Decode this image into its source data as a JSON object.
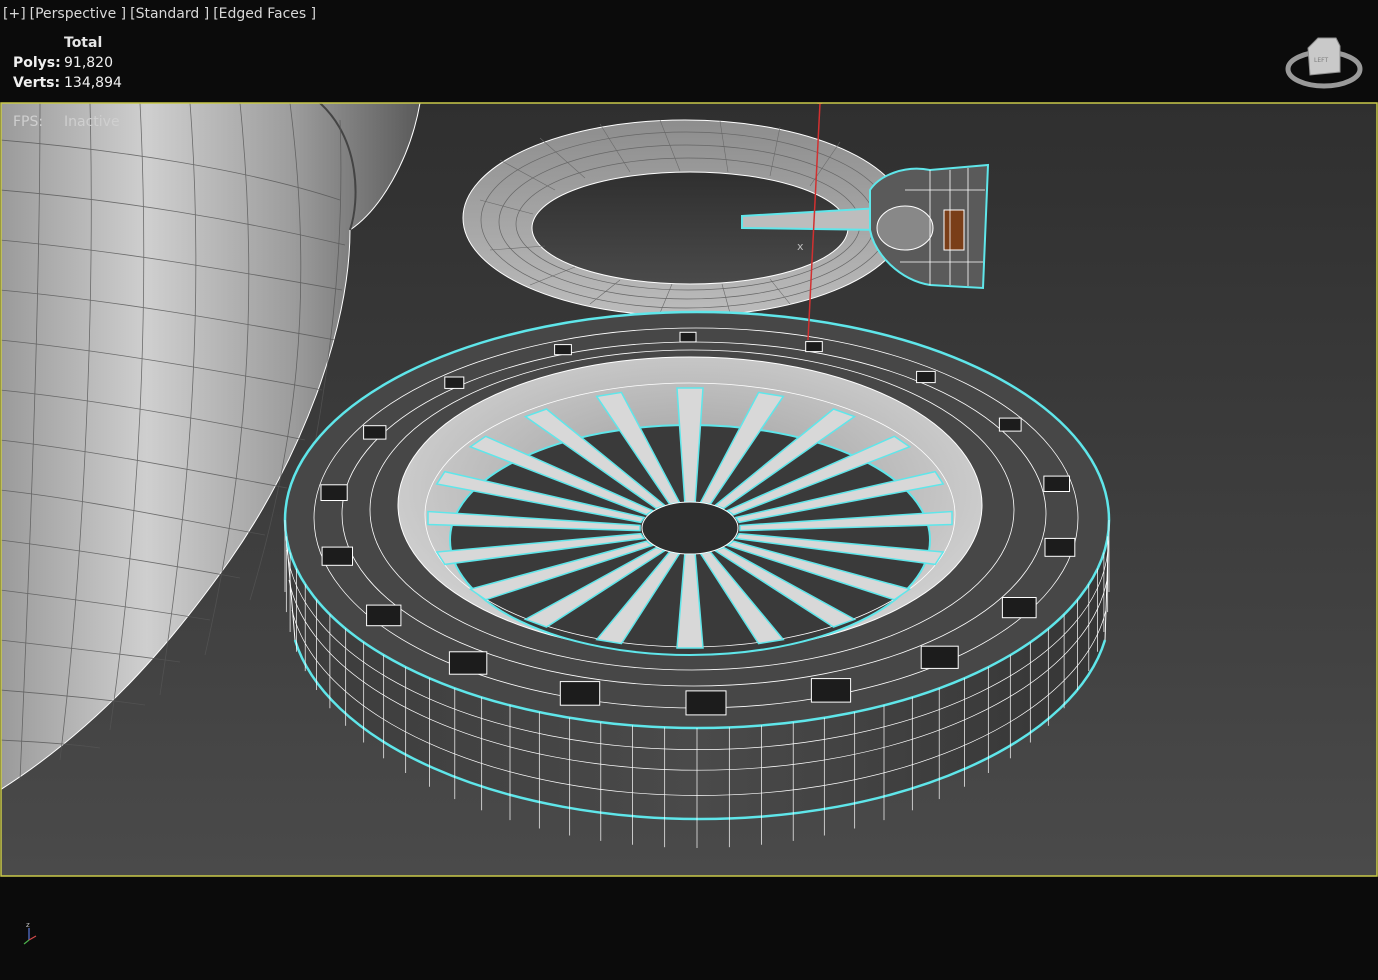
{
  "viewport_menu": {
    "plus": "[+]",
    "view": "[Perspective ]",
    "shading": "[Standard ]",
    "edges": "[Edged Faces ]"
  },
  "stats": {
    "header": "Total",
    "polys_label": "Polys:",
    "polys_value": "91,820",
    "verts_label": "Verts:",
    "verts_value": "134,894"
  },
  "fps": {
    "label": "FPS:",
    "value": "Inactive"
  },
  "viewcube": {
    "face_label": "LEFT"
  },
  "axis_labels": {
    "z": "z",
    "x": "x"
  },
  "colors": {
    "viewport_border": "#c9c94a",
    "selection_outline": "#5fe6ea",
    "wire": "#ffffff",
    "background": "#3c3c3c"
  }
}
